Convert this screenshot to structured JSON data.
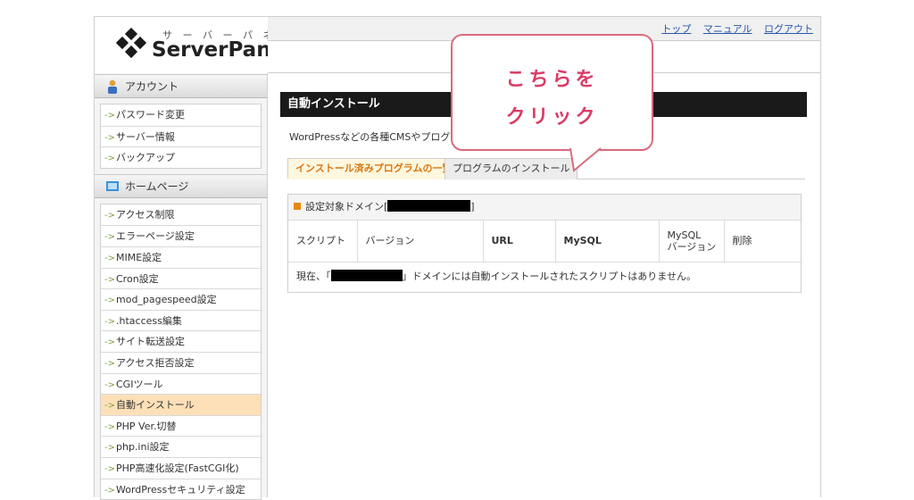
{
  "header": {
    "logo_kana": "サ ー バ ー パ ネ ル",
    "logo_text": "ServerPanel",
    "links": [
      "トップ",
      "マニュアル",
      "ログアウト"
    ]
  },
  "sidebar": {
    "account_title": "アカウント",
    "account_items": [
      "パスワード変更",
      "サーバー情報",
      "バックアップ"
    ],
    "homepage_title": "ホームページ",
    "homepage_items": [
      "アクセス制限",
      "エラーページ設定",
      "MIME設定",
      "Cron設定",
      "mod_pagespeed設定",
      ".htaccess編集",
      "サイト転送設定",
      "アクセス拒否設定",
      "CGIツール",
      "自動インストール",
      "PHP Ver.切替",
      "php.ini設定",
      "PHP高速化設定(FastCGI化)",
      "WordPressセキュリティ設定"
    ],
    "active_item": "自動インストール"
  },
  "main": {
    "title": "自動インストール",
    "description": "WordPressなどの各種CMSやプログラ",
    "tabs": [
      "インストール済みプログラムの一覧",
      "プログラムのインストール"
    ],
    "panel_head_prefix": "設定対象ドメイン[",
    "panel_head_suffix": "]",
    "columns": [
      "スクリプト",
      "バージョン",
      "URL",
      "MySQL",
      "MySQL\nバージョン",
      "削除"
    ],
    "empty_prefix": "現在、「",
    "empty_suffix": "」ドメインには自動インストールされたスクリプトはありません。"
  },
  "callout": {
    "line1": "こちらを",
    "line2": "クリック"
  },
  "colors": {
    "accent_orange": "#e8870d",
    "callout_pink": "#d96b7e",
    "active_item_bg": "#fde0b8"
  }
}
